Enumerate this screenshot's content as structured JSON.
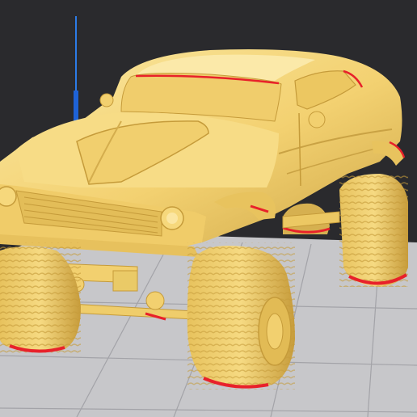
{
  "viewer": {
    "background_color": "#2a2a2d",
    "bed_color": "#c7c7ca",
    "bed_grid_color": "#a3a3a8",
    "model_color": "#f3d171",
    "model_shadow_color": "#c8a23f",
    "overhang_color": "#e8212a",
    "axis_color": "#2c7be5",
    "model_icon": "monster-truck-model-icon"
  }
}
